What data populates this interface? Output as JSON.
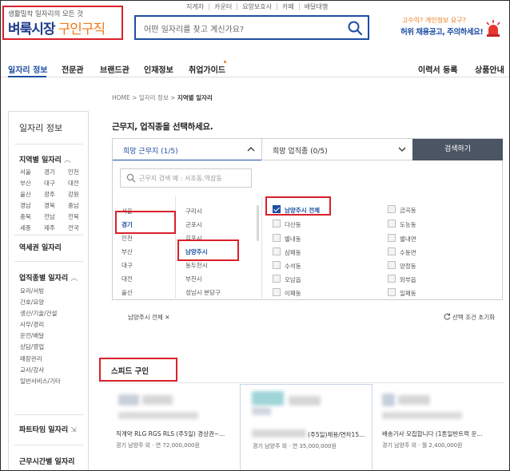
{
  "header": {
    "util_links": [
      "지게차",
      "카운터",
      "요양보호사",
      "카페",
      "배달대행"
    ],
    "logo_tagline": "생활밀착 일자리의 모든 것",
    "logo_main": "벼룩시장",
    "logo_sub": "구인구직",
    "search_placeholder": "어떤 일자리를 찾고 계신가요?",
    "promo_line1": "고수익? 개인정보 요구?",
    "promo_line2": "허위 채용공고, 주의하세요!"
  },
  "gnb": {
    "items": [
      "일자리 정보",
      "전문관",
      "브랜드관",
      "인재정보",
      "취업가이드"
    ],
    "right": [
      "이력서 등록",
      "상품안내"
    ]
  },
  "breadcrumb": {
    "home": "HOME",
    "sep": ">",
    "level1": "일자리 정보",
    "current": "지역별 일자리"
  },
  "sidebar": {
    "title": "일자리 정보",
    "region_title": "지역별 일자리",
    "regions": [
      "서울",
      "경기",
      "인천",
      "부산",
      "대구",
      "대전",
      "울산",
      "광주",
      "강원",
      "경남",
      "경북",
      "충남",
      "충북",
      "전남",
      "전북",
      "세종",
      "제주",
      "전국"
    ],
    "station_title": "역세권 일자리",
    "job_title": "업직종별 일자리",
    "jobs": [
      "요리/서빙",
      "간호/요양",
      "생산/기술/건설",
      "사무/경리",
      "운전/배달",
      "상담/영업",
      "매장관리",
      "교사/강사",
      "일반서비스/기타"
    ],
    "parttime_title": "파트타임 일자리",
    "time_title": "근무시간별 일자리"
  },
  "filter": {
    "heading": "근무지, 업직종을 선택하세요.",
    "tab_location": "희망 근무지 (1/5)",
    "tab_job": "희망 업직종 (0/5)",
    "search_button": "검색하기",
    "region_search_placeholder": "근무지 검색 예 : 서초동,역삼동",
    "provinces": [
      "서울",
      "경기",
      "인천",
      "부산",
      "대구",
      "대전",
      "울산"
    ],
    "cities": [
      "구리시",
      "군포시",
      "김포시",
      "남양주시",
      "동두천시",
      "부천시",
      "성남시 분당구"
    ],
    "district_all": "남양주시 전체",
    "districts_left": [
      "다산동",
      "별내동",
      "삼패동",
      "수석동",
      "오남읍",
      "이패동"
    ],
    "districts_right": [
      "금곡동",
      "도농동",
      "별내면",
      "수동면",
      "양정동",
      "와부읍",
      "일패동"
    ],
    "selected_tag": "남양주시 전체 ✕",
    "reset": "선택 조건 초기화"
  },
  "speed": {
    "title": "스피드 구인",
    "cards": [
      {
        "title": "직계약 RLG RGS RLS (주5일) 경상권~...",
        "meta": "경기 남양주 외 · 연 72,000,000원"
      },
      {
        "title": "(주5일)채용/연차15...",
        "meta": "경기 남양주 외 · 연 35,000,000원"
      },
      {
        "title": "배송기사 모집합니다 (1톤일반트럭 운...",
        "meta": "경기 남양주 외 · 월 2,400,000원"
      }
    ]
  },
  "colors": {
    "brand": "#1e4fa3",
    "accent": "#f07a1a",
    "annotation": "#d9202a"
  }
}
